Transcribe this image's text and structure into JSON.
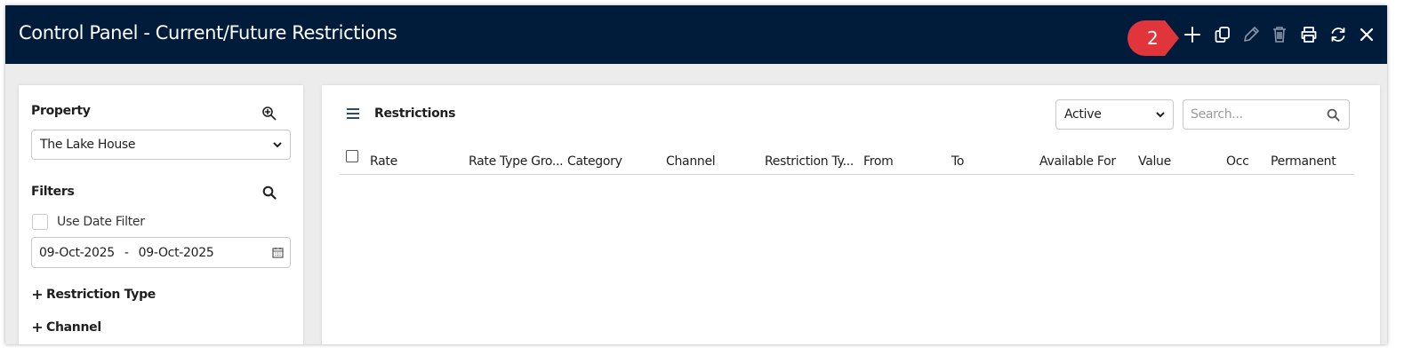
{
  "window": {
    "title": "Control Panel - Current/Future Restrictions"
  },
  "toolbar": {
    "step_badge": "2",
    "icons": [
      "add-icon",
      "copy-icon",
      "edit-icon",
      "delete-icon",
      "print-icon",
      "refresh-icon",
      "close-icon"
    ]
  },
  "sidebar": {
    "property_label": "Property",
    "property_value": "The Lake House",
    "filters_label": "Filters",
    "use_date_filter_label": "Use Date Filter",
    "date_from": "09-Oct-2025",
    "date_separator": "-",
    "date_to": "09-Oct-2025",
    "expanders": [
      {
        "label": "Restriction Type"
      },
      {
        "label": "Channel"
      }
    ]
  },
  "main": {
    "section_title": "Restrictions",
    "status_filter": "Active",
    "search_placeholder": "Search...",
    "columns": [
      "Rate",
      "Rate Type Gro...",
      "Category",
      "Channel",
      "Restriction Ty...",
      "From",
      "To",
      "Available For",
      "Value",
      "Occ",
      "Permanent"
    ]
  },
  "colors": {
    "titlebar_bg": "#011c3a",
    "badge_red": "#e0353a",
    "panel_bg": "#ececec"
  }
}
